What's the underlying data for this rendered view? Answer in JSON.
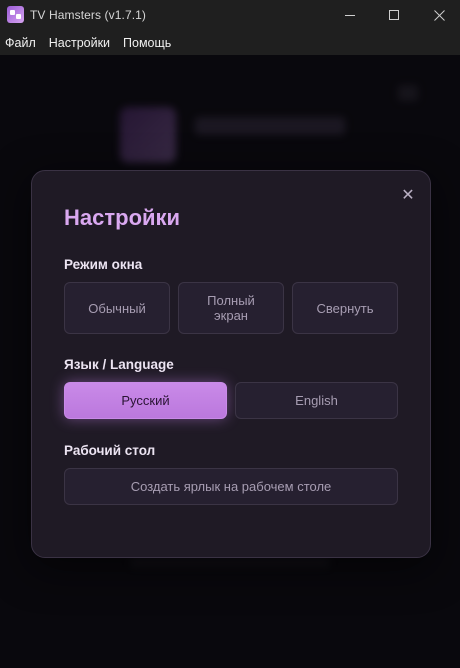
{
  "window": {
    "title": "TV Hamsters (v1.7.1)"
  },
  "menu": {
    "items": [
      "Файл",
      "Настройки",
      "Помощь"
    ]
  },
  "settings_modal": {
    "title": "Настройки",
    "close_glyph": "✕",
    "window_mode": {
      "label": "Режим окна",
      "options": [
        "Обычный",
        "Полный экран",
        "Свернуть"
      ]
    },
    "language": {
      "label": "Язык / Language",
      "options": [
        "Русский",
        "English"
      ],
      "selected": "Русский"
    },
    "desktop": {
      "label": "Рабочий стол",
      "shortcut_button": "Создать ярлык на рабочем столе"
    }
  },
  "colors": {
    "accent": "#c98ae8",
    "title_accent": "#d9a8f0",
    "modal_bg": "#1f1a25",
    "titlebar_bg": "#1f1f1f"
  }
}
